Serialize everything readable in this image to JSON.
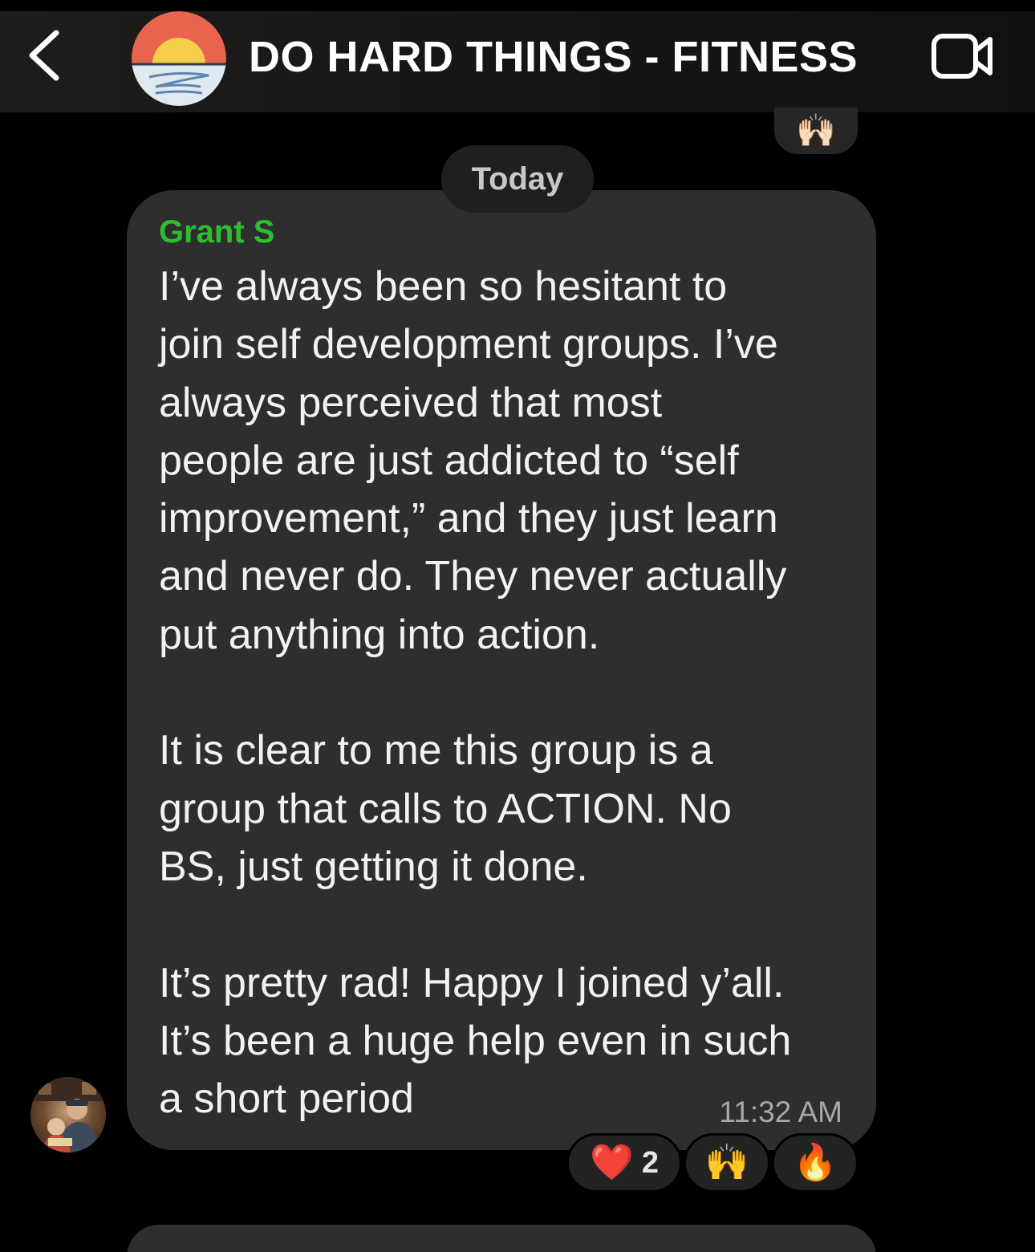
{
  "header": {
    "title": "DO HARD THINGS - FITNESS",
    "back_icon": "chevron-left-icon",
    "video_icon": "video-camera-icon"
  },
  "previous_message": {
    "reaction_emoji": "🙌🏻"
  },
  "date_separator": "Today",
  "message": {
    "sender": "Grant S",
    "sender_color": "#2dbe2d",
    "text": "I’ve always been so hesitant to\njoin self development groups. I’ve\nalways perceived that most\npeople are just addicted to “self\nimprovement,” and they just learn\nand never do. They never actually\nput anything into action.\n\nIt is clear to me this group is a\ngroup that calls to ACTION. No\nBS, just getting it done.\n\nIt’s pretty rad! Happy I joined y’all.\nIt’s been a huge help even in such\na short period",
    "time": "11:32 AM",
    "reactions": [
      {
        "emoji": "❤️",
        "count": "2"
      },
      {
        "emoji": "🙌",
        "count": ""
      },
      {
        "emoji": "🔥",
        "count": ""
      }
    ]
  },
  "colors": {
    "background": "#000000",
    "bubble": "#2e2e2e",
    "header": "#181716"
  }
}
